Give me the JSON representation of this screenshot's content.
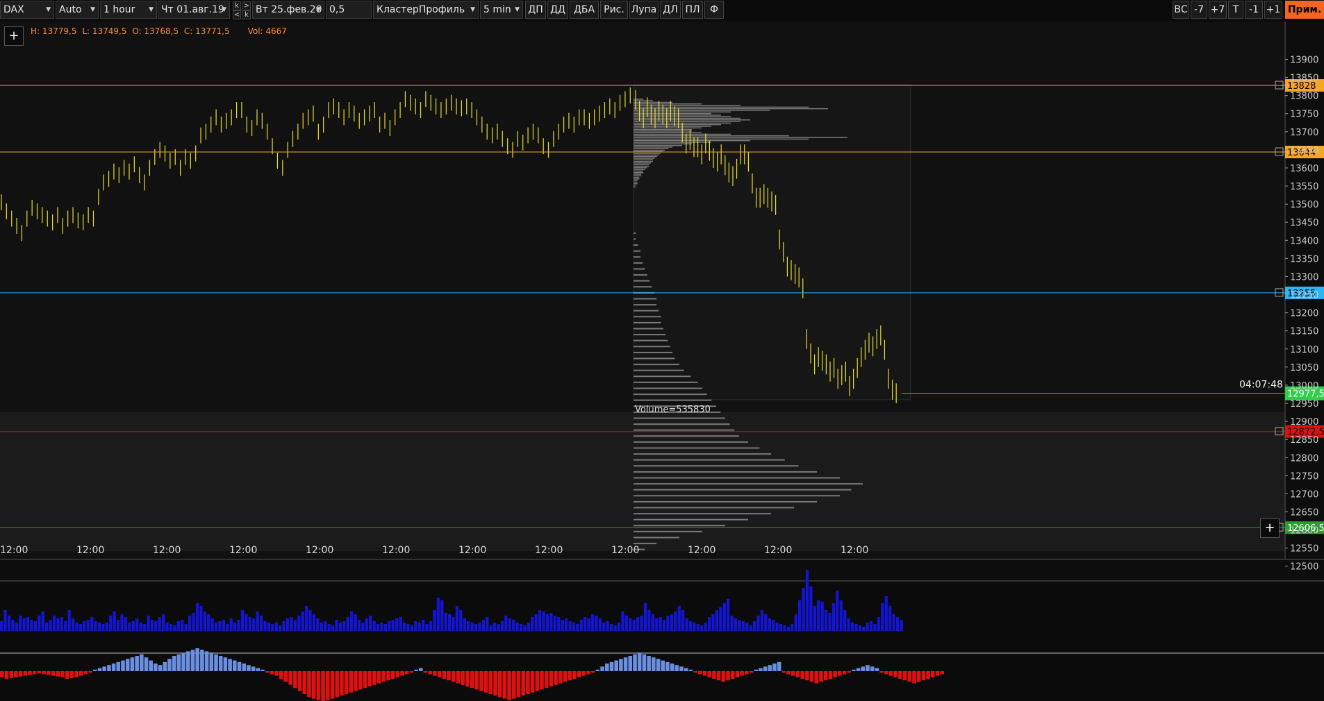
{
  "toolbar": {
    "symbol": "DAX",
    "scale_mode": "Auto",
    "timeframe": "1 hour",
    "date_from": "Чт 01.авг.19",
    "date_to": "Вт 25.фев.20",
    "step": "0,5",
    "chart_type": "КластерПрофиль",
    "sub_timeframe": "5 min",
    "buttons": [
      "ДП",
      "ДД",
      "ДБА",
      "Рис.",
      "Лупа",
      "ДЛ",
      "ПЛ",
      "Ф"
    ],
    "right_buttons": [
      "ВС",
      "-7",
      "+7",
      "T",
      "-1",
      "+1"
    ],
    "prim_label": "Прим."
  },
  "nav_glyphs": {
    "k_top": "k",
    "gt": ">",
    "lt": "<",
    "k_bot": "k"
  },
  "info": {
    "h": "H: 13779,5",
    "l": "L: 13749,5",
    "o": "O: 13768,5",
    "c": "C: 13771,5",
    "vol": "Vol: 4667"
  },
  "plus_label": "+",
  "timer": "04:07:48",
  "profile_volume_label": "Volume=535830",
  "price_axis": {
    "ticks": [
      "13900",
      "13850",
      "13800",
      "13750",
      "13700",
      "13650",
      "13600",
      "13550",
      "13500",
      "13450",
      "13400",
      "13350",
      "13300",
      "13250",
      "13200",
      "13150",
      "13100",
      "13050",
      "13000",
      "12950",
      "12900",
      "12850",
      "12800",
      "12750",
      "12700",
      "12650",
      "12600",
      "12550",
      "12500"
    ]
  },
  "time_axis": {
    "labels": [
      "12:00",
      "12:00",
      "12:00",
      "12:00",
      "12:00",
      "12:00",
      "12:00",
      "12:00",
      "12:00",
      "12:00",
      "12:00",
      "12:00"
    ]
  },
  "levels": [
    {
      "price": 13828,
      "label": "13828",
      "color": "#f5a623",
      "text_color": "#000"
    },
    {
      "price": 13644,
      "label": "13644",
      "color": "#f5a623",
      "text_color": "#000"
    },
    {
      "price": 13255,
      "label": "13255",
      "color": "#29b6f6",
      "text_color": "#000"
    },
    {
      "price": 12872,
      "label": "12872,5",
      "color": "#e01010",
      "text_color": "#000"
    },
    {
      "price": 12606.5,
      "label": "12606,5",
      "color": "#27a02e",
      "text_color": "#fff"
    }
  ],
  "current_price": {
    "price": 12977.5,
    "label": "12977,5",
    "color": "#2fcf4a"
  },
  "colors": {
    "candle": "#e8e02a",
    "volume_bar": "#1414d8",
    "delta_pos": "#6a8fe0",
    "delta_neg": "#e01010",
    "profile": "#7a7a7a",
    "background": "#111111"
  },
  "chart_data": {
    "type": "bar",
    "price_ohlc_hourly": [
      13505,
      13480,
      13460,
      13440,
      13420,
      13460,
      13490,
      13480,
      13470,
      13460,
      13450,
      13470,
      13440,
      13460,
      13470,
      13455,
      13450,
      13470,
      13460,
      13520,
      13560,
      13570,
      13590,
      13580,
      13600,
      13590,
      13610,
      13580,
      13560,
      13600,
      13630,
      13650,
      13640,
      13620,
      13630,
      13600,
      13630,
      13620,
      13640,
      13690,
      13700,
      13720,
      13740,
      13720,
      13730,
      13740,
      13760,
      13760,
      13720,
      13710,
      13740,
      13730,
      13700,
      13660,
      13620,
      13600,
      13650,
      13680,
      13700,
      13730,
      13740,
      13750,
      13700,
      13720,
      13760,
      13770,
      13760,
      13740,
      13760,
      13750,
      13730,
      13740,
      13750,
      13760,
      13720,
      13730,
      13710,
      13740,
      13760,
      13790,
      13780,
      13770,
      13760,
      13790,
      13780,
      13770,
      13760,
      13770,
      13780,
      13770,
      13765,
      13770,
      13760,
      13740,
      13720,
      13700,
      13690,
      13700,
      13680,
      13660,
      13650,
      13680,
      13670,
      13690,
      13700,
      13690,
      13660,
      13650,
      13680,
      13700,
      13720,
      13730,
      13720,
      13740,
      13740,
      13730,
      13740,
      13750,
      13760,
      13770,
      13760,
      13780,
      13790,
      13800
    ],
    "price_5min": [
      13790,
      13760,
      13740,
      13770,
      13750,
      13740,
      13760,
      13750,
      13740,
      13760,
      13745,
      13740,
      13700,
      13670,
      13680,
      13660,
      13660,
      13640,
      13670,
      13650,
      13630,
      13620,
      13640,
      13610,
      13590,
      13580,
      13600,
      13640,
      13640,
      13620,
      13560,
      13520,
      13520,
      13530,
      13520,
      13510,
      13500,
      13405,
      13370,
      13330,
      13320,
      13310,
      13300,
      13270,
      13130,
      13090,
      13060,
      13080,
      13070,
      13060,
      13040,
      13050,
      13020,
      13030,
      13040,
      13000,
      13020,
      13050,
      13080,
      13100,
      13120,
      13110,
      13130,
      13140,
      13100,
      13020,
      12990,
      12980
    ],
    "volume": [
      14,
      30,
      22,
      16,
      12,
      22,
      18,
      20,
      16,
      14,
      22,
      28,
      12,
      16,
      22,
      18,
      20,
      14,
      30,
      18,
      12,
      10,
      14,
      16,
      20,
      14,
      12,
      10,
      12,
      22,
      28,
      16,
      24,
      20,
      12,
      14,
      18,
      12,
      10,
      22,
      16,
      14,
      20,
      24,
      12,
      10,
      8,
      14,
      16,
      10,
      22,
      26,
      40,
      36,
      28,
      24,
      18,
      12,
      14,
      16,
      10,
      18,
      12,
      16,
      30,
      24,
      20,
      18,
      28,
      22,
      14,
      12,
      10,
      12,
      8,
      14,
      18,
      20,
      16,
      22,
      28,
      36,
      30,
      24,
      18,
      12,
      14,
      10,
      8,
      16,
      12,
      14,
      20,
      28,
      24,
      16,
      12,
      18,
      22,
      14,
      10,
      12,
      10,
      14,
      16,
      18,
      20,
      12,
      10,
      8,
      14,
      12,
      16,
      10,
      14,
      30,
      48,
      44,
      26,
      24,
      20,
      36,
      30,
      18,
      14,
      12,
      10,
      12,
      16,
      20,
      8,
      12,
      10,
      14,
      22,
      18,
      16,
      12,
      10,
      8,
      12,
      20,
      24,
      30,
      28,
      24,
      26,
      22,
      20,
      16,
      18,
      14,
      12,
      10,
      16,
      20,
      18,
      24,
      22,
      18,
      12,
      14,
      10,
      8,
      12,
      28,
      22,
      18,
      16,
      20,
      22,
      40,
      30,
      24,
      18,
      20,
      16,
      22,
      24,
      28,
      36,
      30,
      18,
      14,
      12,
      10,
      8,
      12,
      20,
      24,
      30,
      34,
      40,
      46,
      22,
      18,
      16,
      14,
      12,
      8,
      14,
      22,
      30,
      24,
      18,
      16,
      12,
      10,
      8,
      6,
      10,
      24,
      44,
      62,
      88,
      64,
      36,
      44,
      42,
      30,
      26,
      40,
      58,
      44,
      30,
      18,
      12,
      10,
      8,
      6,
      12,
      14,
      10,
      20,
      40,
      50,
      36,
      24,
      20,
      16
    ],
    "delta": [
      -8,
      -10,
      -9,
      -8,
      -7,
      -6,
      -5,
      -4,
      -3,
      -4,
      -5,
      -6,
      -7,
      -8,
      -10,
      -9,
      -8,
      -6,
      -4,
      -2,
      2,
      4,
      6,
      8,
      10,
      12,
      14,
      16,
      18,
      20,
      22,
      18,
      14,
      10,
      8,
      12,
      16,
      20,
      22,
      24,
      26,
      28,
      30,
      28,
      26,
      24,
      22,
      20,
      18,
      16,
      14,
      12,
      10,
      8,
      6,
      4,
      2,
      -2,
      -4,
      -6,
      -10,
      -14,
      -18,
      -22,
      -26,
      -30,
      -34,
      -36,
      -38,
      -40,
      -38,
      -36,
      -34,
      -32,
      -30,
      -28,
      -26,
      -24,
      -22,
      -20,
      -18,
      -16,
      -14,
      -12,
      -10,
      -8,
      -6,
      -4,
      -2,
      2,
      4,
      -2,
      -4,
      -6,
      -8,
      -10,
      -12,
      -14,
      -16,
      -18,
      -20,
      -22,
      -24,
      -26,
      -28,
      -30,
      -32,
      -34,
      -36,
      -38,
      -36,
      -34,
      -32,
      -30,
      -28,
      -26,
      -24,
      -22,
      -20,
      -18,
      -16,
      -14,
      -12,
      -10,
      -8,
      -6,
      -4,
      -2,
      2,
      6,
      10,
      12,
      14,
      16,
      18,
      20,
      22,
      24,
      22,
      20,
      18,
      16,
      14,
      12,
      10,
      8,
      6,
      4,
      2,
      -2,
      -4,
      -6,
      -8,
      -10,
      -12,
      -14,
      -12,
      -10,
      -8,
      -6,
      -4,
      -2,
      2,
      4,
      6,
      8,
      10,
      12,
      -2,
      -4,
      -6,
      -8,
      -10,
      -12,
      -14,
      -16,
      -14,
      -12,
      -10,
      -8,
      -6,
      -4,
      -2,
      2,
      4,
      6,
      8,
      6,
      4,
      -2,
      -4,
      -6,
      -8,
      -10,
      -12,
      -14,
      -16,
      -14,
      -12,
      -10,
      -8,
      -6,
      -4
    ],
    "profile_profile": {
      "upper": [
        0.05,
        0.1,
        0.2,
        0.35,
        0.55,
        0.9,
        1.0,
        0.7,
        0.5,
        0.4,
        0.45,
        0.5,
        0.55,
        0.6,
        0.55,
        0.5,
        0.45,
        0.4,
        0.35,
        0.3,
        0.3,
        0.35,
        0.5,
        0.8,
        1.1,
        0.9,
        0.6,
        0.4,
        0.3,
        0.25,
        0.2,
        0.18,
        0.16,
        0.15,
        0.14,
        0.13,
        0.12,
        0.11,
        0.1,
        0.1,
        0.09,
        0.08,
        0.08,
        0.07,
        0.06,
        0.05,
        0.05,
        0.04,
        0.04,
        0.03,
        0.03,
        0.02,
        0.02,
        0.02,
        0.01,
        0.01
      ],
      "lower": [
        0.01,
        0.01,
        0.02,
        0.03,
        0.03,
        0.04,
        0.05,
        0.06,
        0.07,
        0.08,
        0.09,
        0.1,
        0.1,
        0.11,
        0.12,
        0.12,
        0.13,
        0.14,
        0.15,
        0.16,
        0.17,
        0.18,
        0.2,
        0.22,
        0.25,
        0.28,
        0.3,
        0.32,
        0.34,
        0.36,
        0.38,
        0.4,
        0.42,
        0.44,
        0.46,
        0.5,
        0.55,
        0.6,
        0.66,
        0.72,
        0.8,
        0.9,
        1.0,
        0.95,
        0.9,
        0.8,
        0.7,
        0.6,
        0.5,
        0.4,
        0.3,
        0.2,
        0.1,
        0.05
      ]
    }
  }
}
